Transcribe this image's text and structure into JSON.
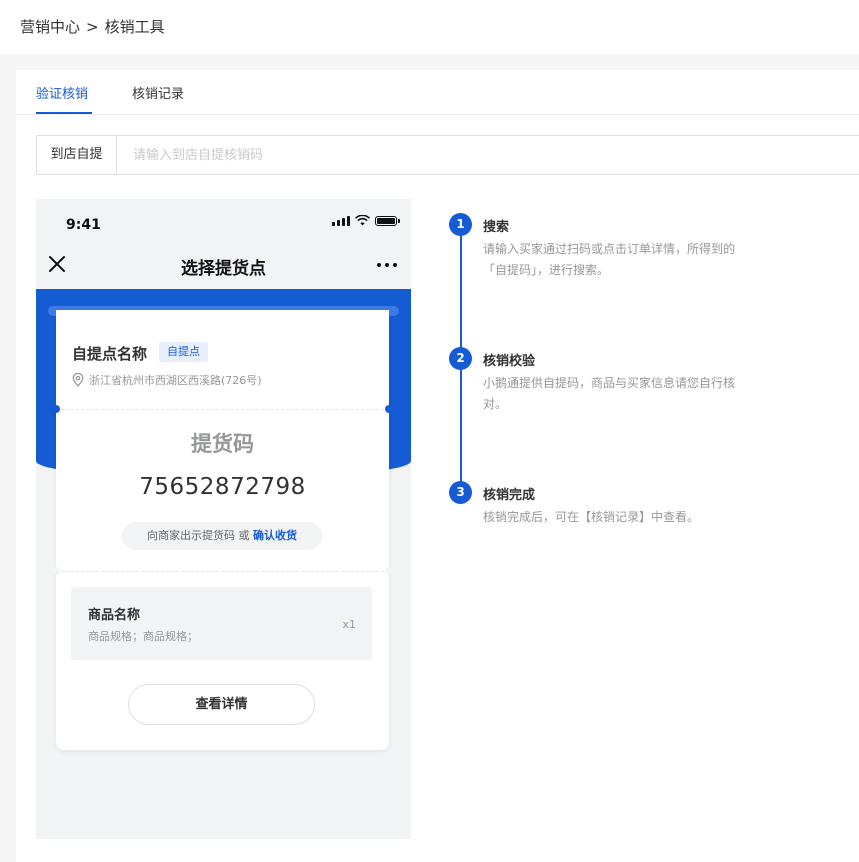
{
  "breadcrumb": {
    "parent": "营销中心",
    "separator": ">",
    "current": "核销工具"
  },
  "tabs": [
    {
      "label": "验证核销",
      "active": true
    },
    {
      "label": "核销记录",
      "active": false
    }
  ],
  "verify": {
    "label": "到店自提",
    "placeholder": "请输入到店自提核销码"
  },
  "phone": {
    "time": "9:41",
    "title": "选择提货点",
    "store": {
      "name": "自提点名称",
      "tag": "自提点",
      "address": "浙江省杭州市西湖区西溪路(726号)"
    },
    "code_title": "提货码",
    "code": "75652872798",
    "hint": "向商家出示提货码 或",
    "confirm_link": "确认收货",
    "goods": {
      "name": "商品名称",
      "spec": "商品规格；商品规格；",
      "qty": "x1"
    },
    "detail_button": "查看详情"
  },
  "steps": [
    {
      "num": "1",
      "title": "搜索",
      "desc": "请输入买家通过扫码或点击订单详情，所得到的「自提码」，进行搜索。"
    },
    {
      "num": "2",
      "title": "核销校验",
      "desc": "小鹅通提供自提码，商品与买家信息请您自行核对。"
    },
    {
      "num": "3",
      "title": "核销完成",
      "desc": "核销完成后，可在【核销记录】中查看。"
    }
  ],
  "colors": {
    "accent": "#155bd4",
    "page_bg": "#f5f5f5"
  },
  "icons": [
    "close-icon",
    "more-icon",
    "signal-icon",
    "wifi-icon",
    "battery-icon",
    "location-icon"
  ]
}
